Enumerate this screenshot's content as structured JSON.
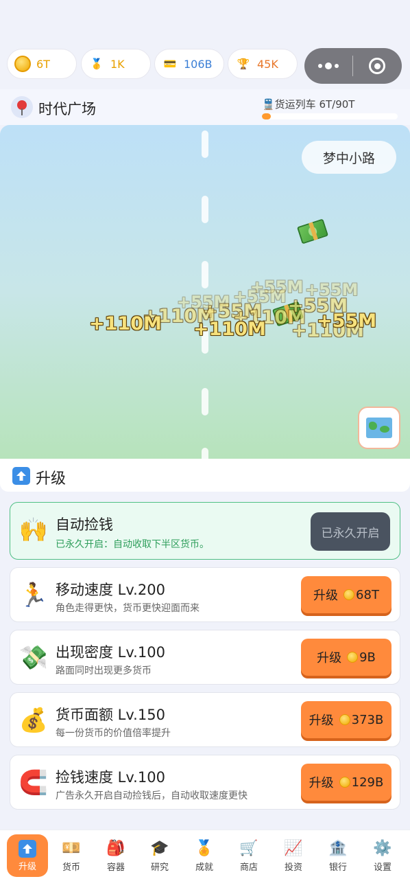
{
  "resources": [
    {
      "icon": "coin-icon",
      "value": "6T",
      "color": "#e8a000"
    },
    {
      "icon": "medal-icon",
      "value": "1K",
      "color": "#e8a000"
    },
    {
      "icon": "card-icon",
      "value": "106B",
      "color": "#3b7fd6"
    },
    {
      "icon": "trophy-icon",
      "value": "45K",
      "color": "#e8772a"
    }
  ],
  "location": {
    "title": "时代广场",
    "train_label": "🚆货运列车  6T/90T",
    "train_progress": 0.067
  },
  "game": {
    "road_button": "梦中小路",
    "popups": [
      {
        "text": "+110M",
        "style": "solid"
      },
      {
        "text": "+110M",
        "style": "mid"
      },
      {
        "text": "+55M",
        "style": "faint"
      },
      {
        "text": "+55M",
        "style": "mid"
      },
      {
        "text": "+110M",
        "style": "solid"
      },
      {
        "text": "+110M",
        "style": "mid"
      },
      {
        "text": "+55M",
        "style": "faint"
      },
      {
        "text": "+55M",
        "style": "faint"
      },
      {
        "text": "+55M",
        "style": "faint"
      },
      {
        "text": "+55M",
        "style": "solid"
      },
      {
        "text": "+110M",
        "style": "mid"
      },
      {
        "text": "+55M",
        "style": "mid"
      }
    ]
  },
  "upgrade": {
    "title": "升级",
    "auto": {
      "title": "自动捡钱",
      "subtitle": "已永久开启：自动收取下半区货币。",
      "button": "已永久开启"
    },
    "items": [
      {
        "title": "移动速度  Lv.200",
        "subtitle": "角色走得更快，货币更快迎面而来",
        "button_prefix": "升级",
        "cost": "68T",
        "icon": "runner-icon"
      },
      {
        "title": "出现密度  Lv.100",
        "subtitle": "路面同时出现更多货币",
        "button_prefix": "升级",
        "cost": "9B",
        "icon": "money-wings-icon"
      },
      {
        "title": "货币面额  Lv.150",
        "subtitle": "每一份货币的价值倍率提升",
        "button_prefix": "升级",
        "cost": "373B",
        "icon": "money-bag-icon"
      },
      {
        "title": "捡钱速度  Lv.100",
        "subtitle": "广告永久开启自动捡钱后，自动收取速度更快",
        "button_prefix": "升级",
        "cost": "129B",
        "icon": "magnet-icon"
      }
    ]
  },
  "tabs": [
    {
      "label": "升级",
      "icon": "upgrade-icon",
      "active": true
    },
    {
      "label": "货币",
      "icon": "banknote-icon"
    },
    {
      "label": "容器",
      "icon": "backpack-icon"
    },
    {
      "label": "研究",
      "icon": "graduation-cap-icon"
    },
    {
      "label": "成就",
      "icon": "medal-icon"
    },
    {
      "label": "商店",
      "icon": "cart-icon"
    },
    {
      "label": "投资",
      "icon": "chart-icon"
    },
    {
      "label": "银行",
      "icon": "bank-icon"
    },
    {
      "label": "设置",
      "icon": "gear-icon"
    }
  ]
}
